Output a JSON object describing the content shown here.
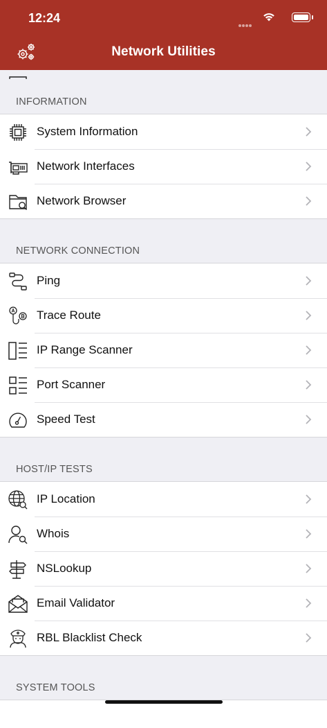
{
  "status_bar": {
    "time": "12:24"
  },
  "nav": {
    "title": "Network Utilities"
  },
  "sections": [
    {
      "title": "INFORMATION",
      "items": [
        {
          "label": "System Information"
        },
        {
          "label": "Network Interfaces"
        },
        {
          "label": "Network Browser"
        }
      ]
    },
    {
      "title": "NETWORK CONNECTION",
      "items": [
        {
          "label": "Ping"
        },
        {
          "label": "Trace Route"
        },
        {
          "label": "IP Range Scanner"
        },
        {
          "label": "Port Scanner"
        },
        {
          "label": "Speed Test"
        }
      ]
    },
    {
      "title": "HOST/IP TESTS",
      "items": [
        {
          "label": "IP Location"
        },
        {
          "label": "Whois"
        },
        {
          "label": "NSLookup"
        },
        {
          "label": "Email Validator"
        },
        {
          "label": "RBL Blacklist Check"
        }
      ]
    },
    {
      "title": "SYSTEM TOOLS",
      "items": []
    }
  ],
  "colors": {
    "header": "#a83226",
    "background": "#efeff4"
  }
}
